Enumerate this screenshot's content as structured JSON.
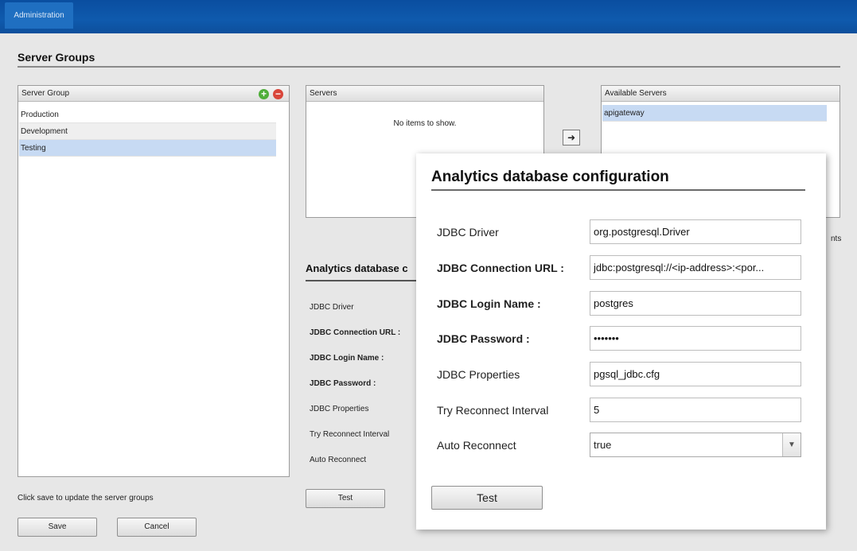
{
  "app": {
    "tab_label": "Administration"
  },
  "page": {
    "title": "Server Groups",
    "hint": "Click save to update the server groups"
  },
  "server_groups": {
    "header": "Server Group",
    "items": [
      {
        "label": "Production"
      },
      {
        "label": "Development"
      },
      {
        "label": "Testing"
      }
    ],
    "selected_index": 2
  },
  "servers": {
    "header": "Servers",
    "empty_text": "No items to show."
  },
  "available_servers": {
    "header": "Available Servers",
    "items": [
      {
        "label": "apigateway"
      }
    ]
  },
  "background_form": {
    "title": "Analytics database c",
    "labels": [
      "JDBC Driver",
      "JDBC Connection URL :",
      "JDBC Login Name :",
      "JDBC Password :",
      "JDBC Properties",
      "Try Reconnect Interval",
      "Auto Reconnect"
    ],
    "test_label": "Test",
    "partial_text": "nts"
  },
  "buttons": {
    "save": "Save",
    "cancel": "Cancel"
  },
  "dialog": {
    "title": "Analytics database configuration",
    "fields": [
      {
        "label": "JDBC Driver",
        "value": "org.postgresql.Driver"
      },
      {
        "label": "JDBC Connection URL :",
        "value": "jdbc:postgresql://<ip-address>:<por..."
      },
      {
        "label": "JDBC Login Name :",
        "value": "postgres"
      },
      {
        "label": "JDBC Password :",
        "value": "•••••••"
      },
      {
        "label": "JDBC Properties",
        "value": "pgsql_jdbc.cfg"
      },
      {
        "label": "Try Reconnect Interval",
        "value": "5"
      },
      {
        "label": "Auto Reconnect",
        "value": "true"
      }
    ],
    "test_label": "Test"
  }
}
